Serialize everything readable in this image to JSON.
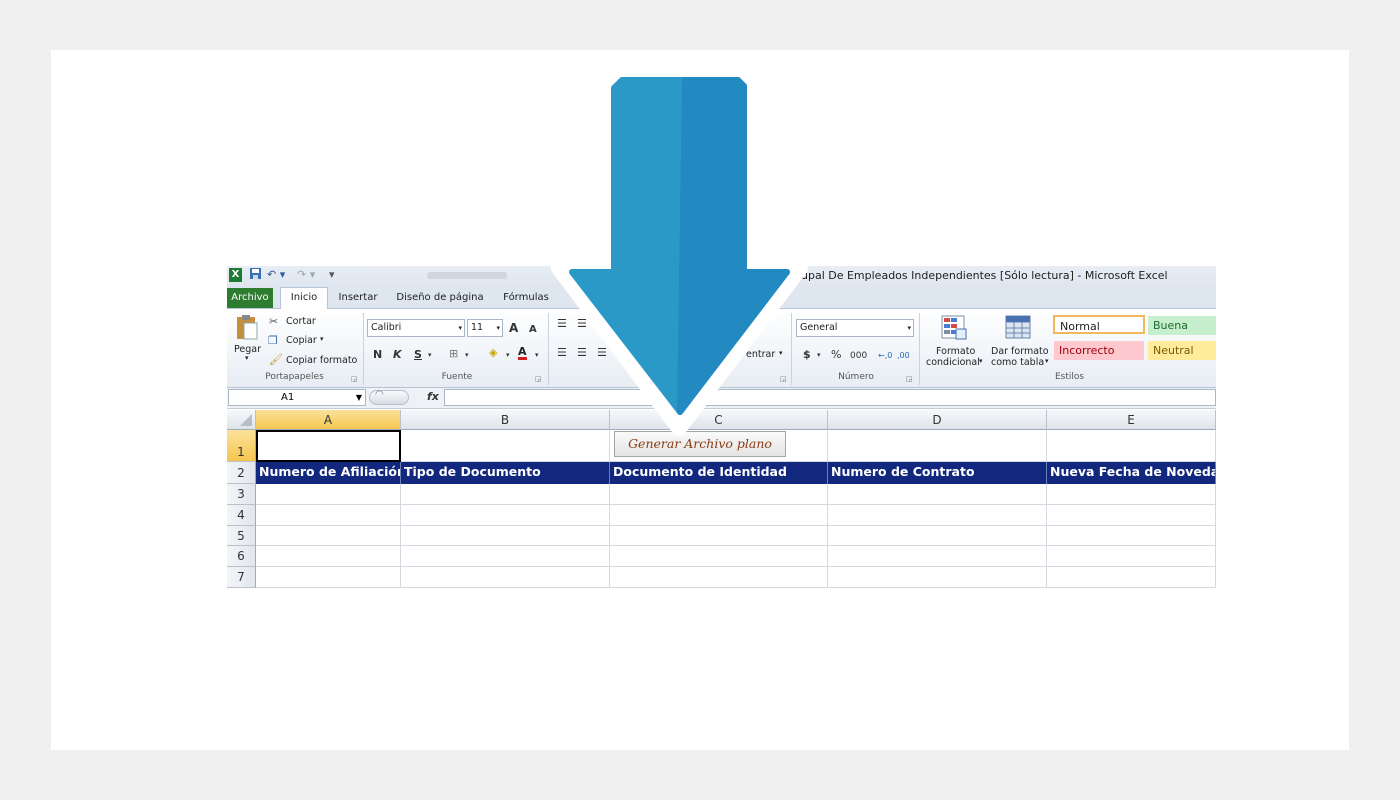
{
  "window": {
    "title": "upal De Empleados Independientes  [Sólo lectura]  -  Microsoft Excel",
    "app_icon": "X"
  },
  "tabs": [
    {
      "label": "Archivo"
    },
    {
      "label": "Inicio"
    },
    {
      "label": "Insertar"
    },
    {
      "label": "Diseño de página"
    },
    {
      "label": "Fórmulas"
    }
  ],
  "ribbon": {
    "clipboard": {
      "paste": "Pegar",
      "cut": "Cortar",
      "copy": "Copiar",
      "format_painter": "Copiar formato",
      "group": "Portapapeles"
    },
    "font": {
      "name": "Calibri",
      "size": "11",
      "bold": "N",
      "italic": "K",
      "underline": "S",
      "grow": "A",
      "shrink": "A",
      "group": "Fuente"
    },
    "alignment": {
      "merge": "entrar"
    },
    "number": {
      "format": "General",
      "currency": "$",
      "percent": "%",
      "thousands": "000",
      "increase_decimal": "←,0",
      ",00": ",00",
      "group": "Número"
    },
    "styles": {
      "conditional_1": "Formato",
      "conditional_2": "condicional",
      "table_1": "Dar formato",
      "table_2": "como tabla",
      "normal": "Normal",
      "good": "Buena",
      "bad": "Incorrecto",
      "neutral": "Neutral",
      "group": "Estilos"
    }
  },
  "formula_bar": {
    "name_box": "A1",
    "fx": "fx",
    "value": ""
  },
  "sheet": {
    "columns": [
      "A",
      "B",
      "C",
      "D",
      "E"
    ],
    "rows": [
      "1",
      "2",
      "3",
      "4",
      "5",
      "6",
      "7"
    ],
    "headers": [
      "Numero de Afiliación",
      "Tipo de Documento",
      "Documento de Identidad",
      "Numero de Contrato",
      "Nueva Fecha de Novedad"
    ],
    "button": "Generar Archivo plano"
  },
  "colors": {
    "header_fill": "#12287e",
    "arrow_fill": "#2a99c7",
    "arrow_shade": "#228ac0"
  },
  "icons": [
    "excel-icon",
    "save-icon",
    "undo-icon",
    "redo-icon",
    "down-arrow-icon"
  ]
}
